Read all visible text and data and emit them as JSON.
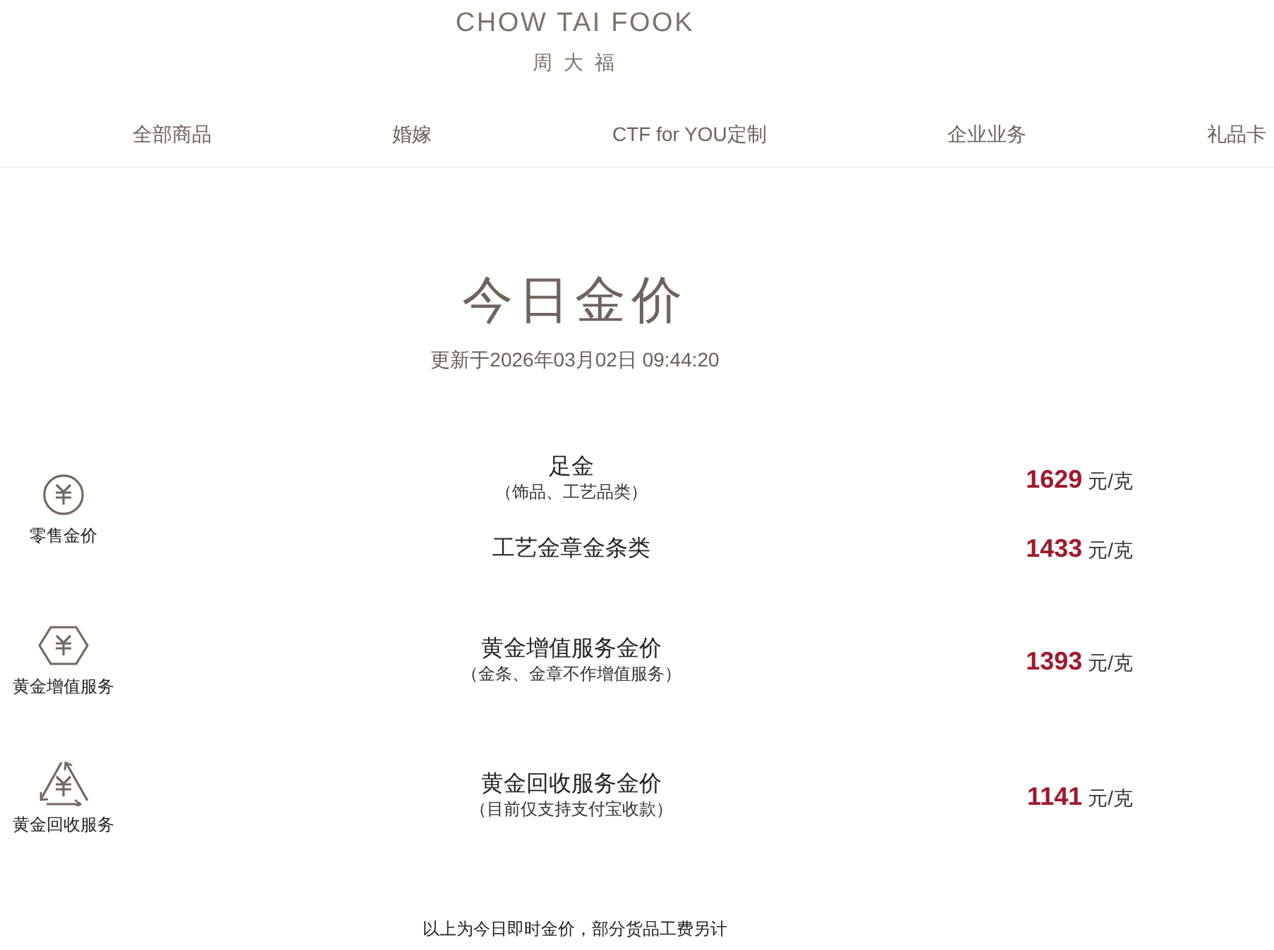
{
  "brand": {
    "name": "CHOW TAI FOOK",
    "name_chinese": "周 大 福"
  },
  "nav": [
    {
      "label": "全部商品"
    },
    {
      "label": "婚嫁"
    },
    {
      "label": "CTF for YOU定制"
    },
    {
      "label": "企业业务"
    },
    {
      "label": "礼品卡"
    }
  ],
  "page_title": "今日金价",
  "updated": "更新于2026年03月02日 09:44:20",
  "categories": [
    {
      "kind": "retail",
      "label": "零售金价",
      "items": [
        {
          "name": "足金",
          "note": "（饰品、工艺品类）",
          "price": "1629",
          "unit": "元/克"
        },
        {
          "name": "工艺金章金条类",
          "price": "1433",
          "unit": "元/克"
        }
      ]
    },
    {
      "kind": "value_added",
      "label": "黄金增值服务",
      "items": [
        {
          "name": "黄金增值服务金价",
          "note": "（金条、金章不作增值服务）",
          "price": "1393",
          "unit": "元/克"
        }
      ]
    },
    {
      "kind": "recycle",
      "label": "黄金回收服务",
      "items": [
        {
          "name": "黄金回收服务金价",
          "note": "（目前仅支持支付宝收款）",
          "price": "1141",
          "unit": "元/克"
        }
      ]
    }
  ],
  "footnote": "以上为今日即时金价，部分货品工费另计"
}
